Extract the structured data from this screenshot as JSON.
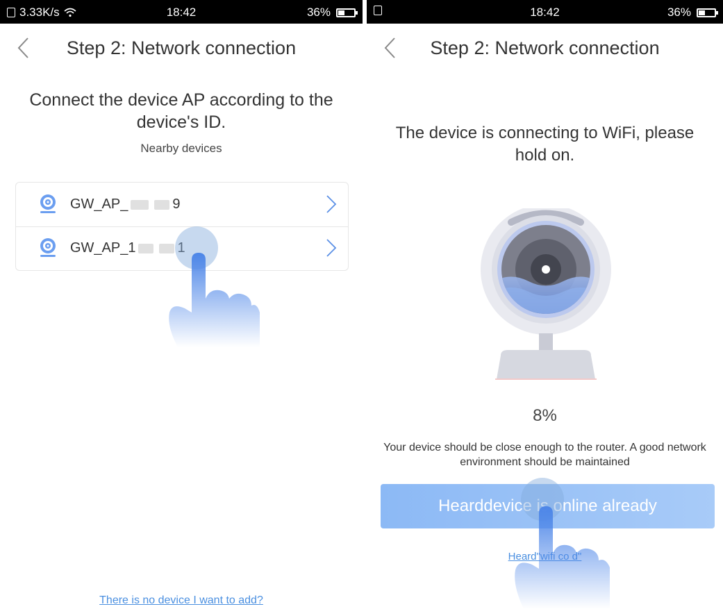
{
  "left_screen": {
    "status": {
      "net_speed": "3.33K/s",
      "time": "18:42",
      "battery": "36%"
    },
    "title": "Step 2: Network connection",
    "instruction": "Connect the device AP according to the device's ID.",
    "nearby_label": "Nearby devices",
    "devices": [
      {
        "prefix": "GW_AP_",
        "suffix": "9"
      },
      {
        "prefix": "GW_AP_1",
        "suffix": "1"
      }
    ],
    "no_device_link": "There is no device I want to add?"
  },
  "right_screen": {
    "status": {
      "time": "18:42",
      "battery": "36%"
    },
    "title": "Step 2: Network connection",
    "connecting_text": "The device is connecting to WiFi, please hold on.",
    "progress_percent": "8%",
    "tip": "Your device should be close enough to the router. A good network environment should be maintained",
    "online_button": "Hearddevice is online already",
    "heard_link": "Heard\"wifi co                  d\""
  },
  "colors": {
    "accent": "#4a8fe0",
    "button": "#9ec3f7",
    "icon_blue": "#5a8fe6"
  }
}
